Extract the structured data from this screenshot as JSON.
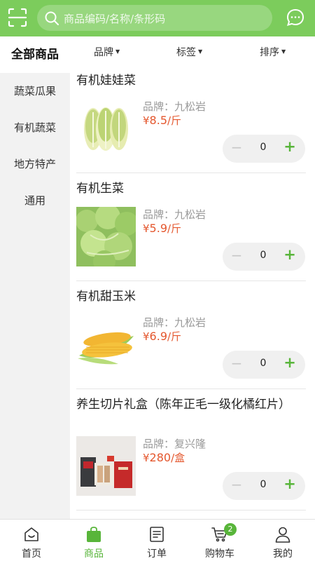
{
  "header": {
    "search_placeholder": "商品编码/名称/条形码"
  },
  "sidebar": {
    "items": [
      {
        "label": "全部商品",
        "active": true
      },
      {
        "label": "蔬菜瓜果",
        "active": false
      },
      {
        "label": "有机蔬菜",
        "active": false
      },
      {
        "label": "地方特产",
        "active": false
      },
      {
        "label": "通用",
        "active": false
      }
    ]
  },
  "filters": {
    "brand": "品牌",
    "tag": "标签",
    "sort": "排序"
  },
  "products": [
    {
      "name": "有机娃娃菜",
      "brand": "品牌：九松岩",
      "currency": "¥",
      "price": "8.5",
      "unit": "/斤",
      "qty": "0",
      "image": "baby-cabbage-image"
    },
    {
      "name": "有机生菜",
      "brand": "品牌：九松岩",
      "currency": "¥",
      "price": "5.9",
      "unit": "/斤",
      "qty": "0",
      "image": "lettuce-image"
    },
    {
      "name": "有机甜玉米",
      "brand": "品牌：九松岩",
      "currency": "¥",
      "price": "6.9",
      "unit": "/斤",
      "qty": "0",
      "image": "sweet-corn-image"
    },
    {
      "name": "养生切片礼盒（陈年正毛一级化橘红片）",
      "brand": "品牌：复兴隆",
      "currency": "¥",
      "price": "280",
      "unit": "/盒",
      "qty": "0",
      "image": "gift-box-image"
    }
  ],
  "stepper": {
    "minus": "−",
    "plus": "+"
  },
  "tabbar": {
    "items": [
      {
        "label": "首页",
        "icon": "home-icon"
      },
      {
        "label": "商品",
        "icon": "shopping-bag-icon",
        "active": true
      },
      {
        "label": "订单",
        "icon": "order-list-icon"
      },
      {
        "label": "购物车",
        "icon": "cart-icon",
        "badge": "2"
      },
      {
        "label": "我的",
        "icon": "user-icon"
      }
    ]
  },
  "colors": {
    "accent_green": "#7ccc5c",
    "active_green": "#58b53a",
    "price_red": "#e4572e"
  }
}
